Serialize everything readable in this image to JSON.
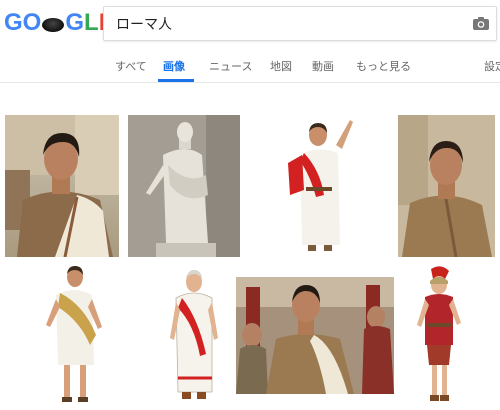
{
  "logo": {
    "text": "GOOGLE"
  },
  "search": {
    "query": "ローマ人"
  },
  "tabs": [
    "すべて",
    "画像",
    "ニュース",
    "地図",
    "動画",
    "もっと見る",
    "設定"
  ],
  "active_tab": "画像",
  "icons": [
    "camera-icon"
  ],
  "colors": {
    "accent": "#1a73e8",
    "toga_red": "#d32020"
  },
  "results": [
    "roman-actor-portrait",
    "roman-toga-statue",
    "red-sash-toga-costume",
    "roman-actor-portrait-2",
    "toga-costume-man",
    "toga-illustration-man",
    "roman-crowd-scene",
    "roman-soldier-illustration"
  ]
}
